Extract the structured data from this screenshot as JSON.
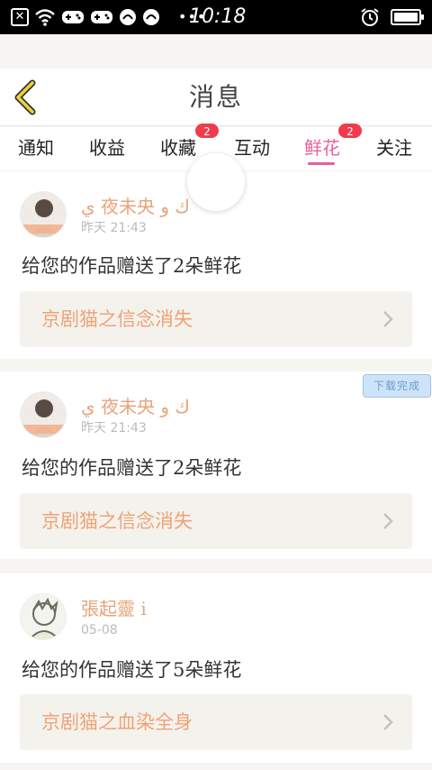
{
  "status_bar": {
    "time": "10:18",
    "battery_level": 1.0
  },
  "header": {
    "title": "消息"
  },
  "tabs": [
    {
      "label": "通知",
      "badge": ""
    },
    {
      "label": "收益",
      "badge": ""
    },
    {
      "label": "收藏",
      "badge": "2"
    },
    {
      "label": "互动",
      "badge": ""
    },
    {
      "label": "鲜花",
      "badge": "2",
      "active": true
    },
    {
      "label": "关注",
      "badge": ""
    }
  ],
  "messages": [
    {
      "user": "ي 夜未央 ك و",
      "time": "昨天 21:43",
      "text": "给您的作品赠送了2朵鲜花",
      "work": "京剧猫之信念消失"
    },
    {
      "user": "ي 夜未央 ك و",
      "time": "昨天 21:43",
      "text": "给您的作品赠送了2朵鲜花",
      "work": "京剧猫之信念消失"
    },
    {
      "user": "張起靈 i",
      "time": "05-08",
      "text": "给您的作品赠送了5朵鲜花",
      "work": "京剧猫之血染全身"
    }
  ],
  "download_badge": "下载完成",
  "colors": {
    "accent": "#e8609a",
    "badge": "#f23a4d",
    "name": "#e9a37a",
    "work_title": "#eea377"
  }
}
